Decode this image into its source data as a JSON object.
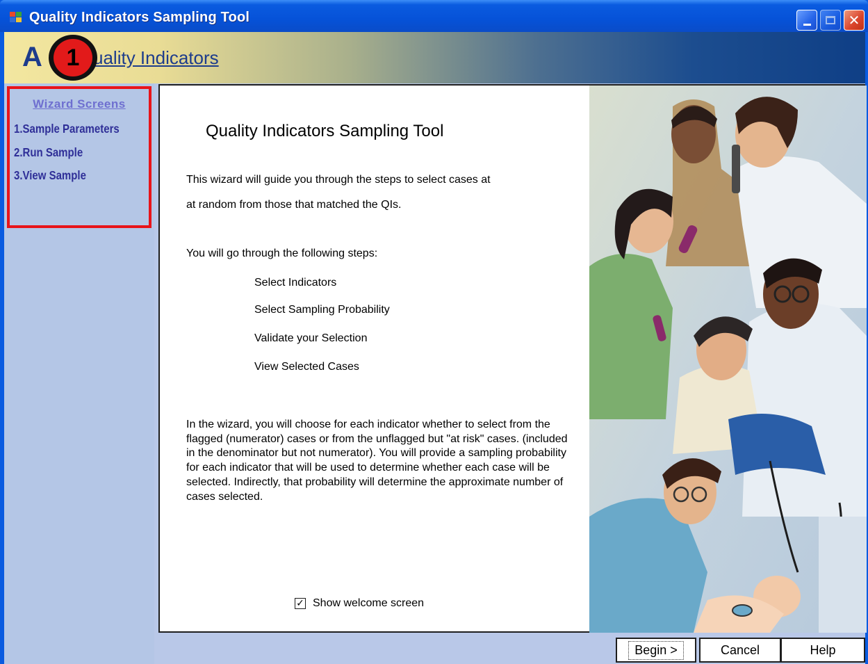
{
  "window": {
    "title": "Quality Indicators Sampling Tool",
    "icon": "app-window-icon",
    "controls": [
      "minimize-icon",
      "maximize-icon",
      "close-icon"
    ]
  },
  "banner": {
    "logo_prefix": "A",
    "logo_text": "uality Indicators",
    "marker_number": "1"
  },
  "sidebar": {
    "title": "Wizard Screens",
    "items": [
      {
        "label": "1.Sample Parameters"
      },
      {
        "label": "2.Run Sample"
      },
      {
        "label": "3.View Sample"
      }
    ],
    "highlight_color": "#e8141a"
  },
  "main": {
    "heading": "Quality Indicators Sampling Tool",
    "intro_line1": "This wizard will guide you through the steps to select cases at",
    "intro_line2": "at random from those that matched the QIs.",
    "steps_intro": "You will go through the following steps:",
    "steps": [
      {
        "label": "Select Indicators"
      },
      {
        "label": "Select Sampling Probability"
      },
      {
        "label": "Validate your Selection"
      },
      {
        "label": "View Selected Cases"
      }
    ],
    "description": "In the wizard, you will choose for each indicator whether to select from the flagged (numerator) cases or from the unflagged but \"at risk\" cases.  (included in the denominator but not numerator).  You will provide a sampling probability for each indicator that will be used to determine whether each case will be selected.  Indirectly, that probability will determine the approximate number of cases selected.",
    "show_welcome": {
      "label": "Show welcome screen",
      "checked": true,
      "check_glyph": "✓"
    }
  },
  "buttons": {
    "begin": "Begin >",
    "cancel": "Cancel",
    "help": "Help"
  },
  "colors": {
    "titlebar": "#0a5be0",
    "sidebar_bg": "#b4c6e6",
    "sidebar_text": "#2f2f98"
  }
}
